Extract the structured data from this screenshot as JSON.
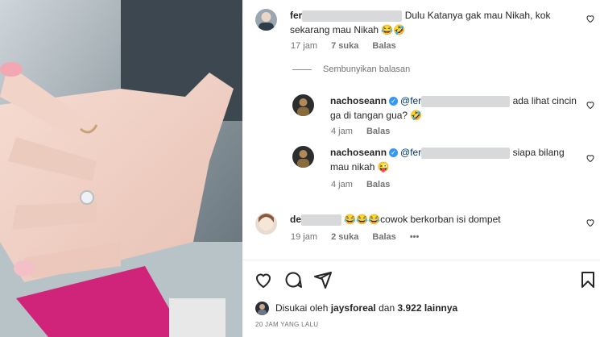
{
  "comments": [
    {
      "username": "fer",
      "text": "Dulu Katanya gak mau Nikah, kok sekarang mau Nikah 😂🤣",
      "time": "17 jam",
      "likes": "7 suka",
      "reply": "Balas"
    },
    {
      "username": "de",
      "text": "😂😂😂cowok berkorban isi dompet",
      "time": "19 jam",
      "likes": "2 suka",
      "reply": "Balas",
      "more": "•••"
    }
  ],
  "hide_replies": "Sembunyikan balasan",
  "replies": [
    {
      "username": "nachoseann",
      "mention": "@fer",
      "text_line1": "ada lihat cincin",
      "text_line2": "ga di tangan gua? 🤣",
      "time": "4 jam",
      "reply": "Balas"
    },
    {
      "username": "nachoseann",
      "mention": "@fer",
      "text_line1": "siapa bilang",
      "text_line2": "mau nikah 😜",
      "time": "4 jam",
      "reply": "Balas"
    }
  ],
  "likes_line": {
    "prefix": "Disukai oleh",
    "user": "jaysforeal",
    "middle": "dan",
    "count": "3.922 lainnya"
  },
  "post_time": "20 JAM YANG LALU",
  "icons": {
    "like": "heart-icon",
    "comment": "comment-icon",
    "share": "send-icon",
    "save": "bookmark-icon"
  }
}
